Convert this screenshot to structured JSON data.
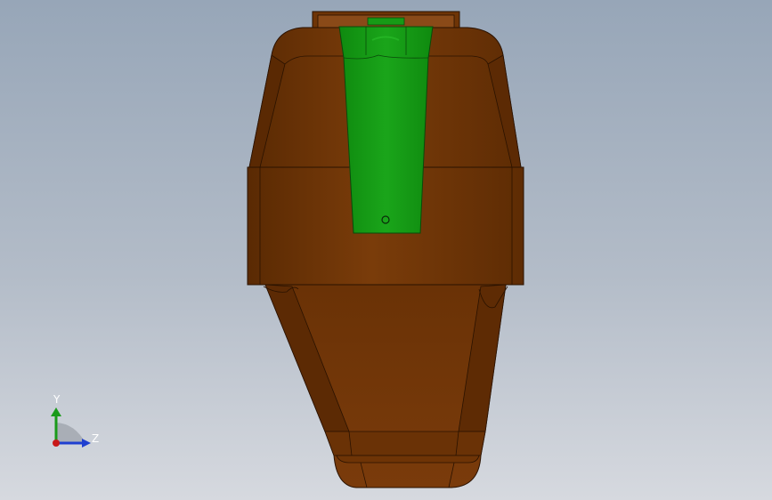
{
  "viewport": {
    "background_top": "#97a6b8",
    "background_bottom": "#d6d9df"
  },
  "model": {
    "body_color": "#6e3406",
    "body_highlight": "#8a4512",
    "edge_color": "#2a1200",
    "insert_color": "#169b16",
    "insert_highlight": "#2bbf2b"
  },
  "triad": {
    "y_label": "Y",
    "z_label": "Z",
    "y_color": "#1a9a1a",
    "z_color": "#1f3fd0",
    "x_color": "#c81818"
  }
}
